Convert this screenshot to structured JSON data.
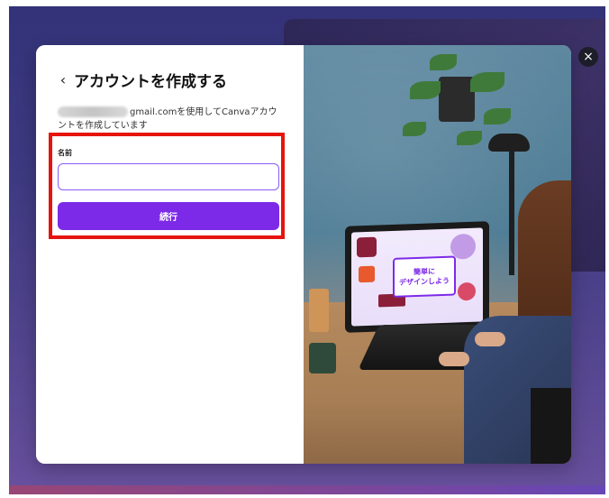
{
  "modal": {
    "title": "アカウントを作成する",
    "back_icon": "chevron-left-icon",
    "email_suffix": "gmail.comを使用してCanvaアカウントを作成しています",
    "name_label": "名前",
    "name_value": "",
    "continue_label": "続行",
    "close_icon": "close-icon",
    "close_glyph": "×",
    "screen_text_line1": "簡単に",
    "screen_text_line2": "デザインしよう"
  },
  "colors": {
    "primary": "#7d2ae8",
    "input_border": "#8b5cf6",
    "highlight": "#e5140f"
  }
}
